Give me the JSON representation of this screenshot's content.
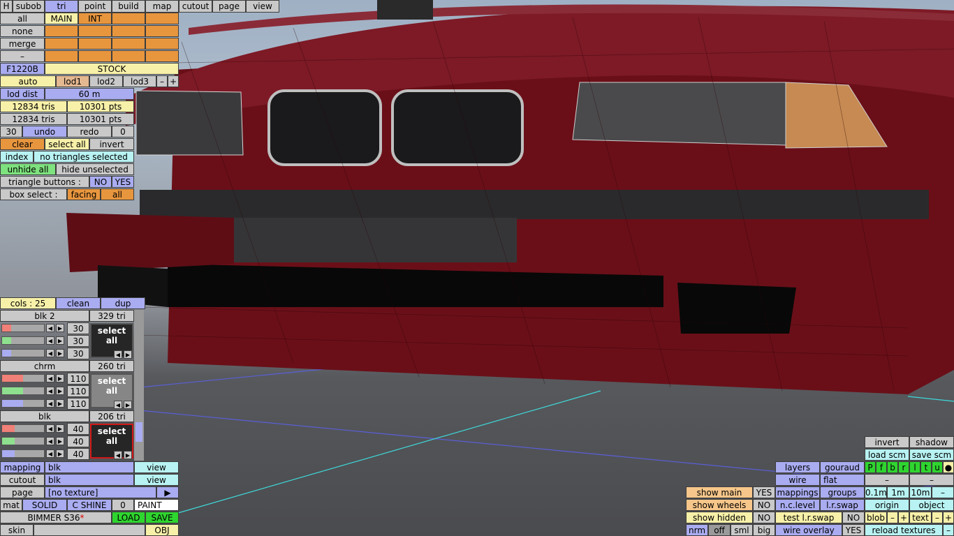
{
  "top_tabs": [
    "H",
    "subob",
    "tri",
    "point",
    "build",
    "map",
    "cutout",
    "page",
    "view"
  ],
  "select": {
    "all": "all",
    "none": "none",
    "merge": "merge",
    "dash": "–",
    "main": "MAIN",
    "int": "INT"
  },
  "model": {
    "code": "F1220B",
    "body": "STOCK"
  },
  "lod": {
    "auto": "auto",
    "lod1": "lod1",
    "lod2": "lod2",
    "lod3": "lod3",
    "minus": "–",
    "plus": "+",
    "dist_label": "lod dist",
    "dist_value": "60 m"
  },
  "stats": {
    "tris1": "12834 tris",
    "pts1": "10301 pts",
    "tris2": "12834 tris",
    "pts2": "10301 pts"
  },
  "history": {
    "count": "30",
    "undo": "undo",
    "redo": "redo",
    "redo_count": "0"
  },
  "tri_actions": {
    "clear": "clear",
    "select_all": "select all",
    "invert": "invert",
    "index": "index",
    "status": "no triangles selected",
    "unhide_all": "unhide all",
    "hide_unselected": "hide unselected",
    "tri_buttons_label": "triangle buttons :",
    "no": "NO",
    "yes": "YES",
    "box_select_label": "box select :",
    "facing": "facing",
    "all": "all"
  },
  "cols": {
    "label": "cols : 25",
    "clean": "clean",
    "dup": "dup"
  },
  "materials": [
    {
      "name": "blk 2",
      "tris": "329 tri",
      "vals": [
        "30",
        "30",
        "30"
      ],
      "fills": [
        0.21,
        0.22,
        0.22,
        0.08
      ],
      "swatch": "#262626",
      "sel": "select all"
    },
    {
      "name": "chrm",
      "tris": "260 tri",
      "vals": [
        "110",
        "110",
        "110"
      ],
      "fills": [
        0.5,
        0.5,
        0.5,
        0.35
      ],
      "swatch": "#868686",
      "sel": "select all"
    },
    {
      "name": "blk",
      "tris": "206 tri",
      "vals": [
        "40",
        "40",
        "40"
      ],
      "fills": [
        0.3,
        0.3,
        0.3,
        0.08
      ],
      "swatch": "#262626",
      "sel": "select all"
    }
  ],
  "bottom_left": {
    "mapping": "mapping",
    "mapping_val": "blk",
    "view": "view",
    "cutout": "cutout",
    "cutout_val": "blk",
    "page": "page",
    "page_val": "[no texture]",
    "play": "▶",
    "mat": "mat",
    "solid": "SOLID",
    "cshine": "C SHINE",
    "zero": "0",
    "paint": "PAINT",
    "car": "BIMMER S36",
    "star": "*",
    "load": "LOAD",
    "save": "SAVE",
    "skin": "skin",
    "obj": "OBJ"
  },
  "bottom_right": {
    "show_main": "show main",
    "show_wheels": "show wheels",
    "show_hidden": "show hidden",
    "yes": "YES",
    "no": "NO",
    "nrm": "nrm",
    "off": "off",
    "sml": "sml",
    "big": "big",
    "layers": "layers",
    "gouraud": "gouraud",
    "wire": "wire",
    "flat": "flat",
    "mappings": "mappings",
    "groups": "groups",
    "nclevel": "n.c.level",
    "lrswap": "l.r.swap",
    "test_lrswap": "test l.r.swap",
    "wire_overlay": "wire overlay",
    "invert": "invert",
    "shadow": "shadow",
    "load_scm": "load scm",
    "save_scm": "save scm",
    "flags": [
      "P",
      "f",
      "b",
      "r",
      "l",
      "t",
      "u"
    ],
    "dot": "●",
    "dash": "–",
    "s01": "0.1m",
    "s1": "1m",
    "s10": "10m",
    "origin": "origin",
    "object": "object",
    "blob": "blob",
    "plus": "+",
    "text": "text",
    "reload": "reload textures"
  }
}
